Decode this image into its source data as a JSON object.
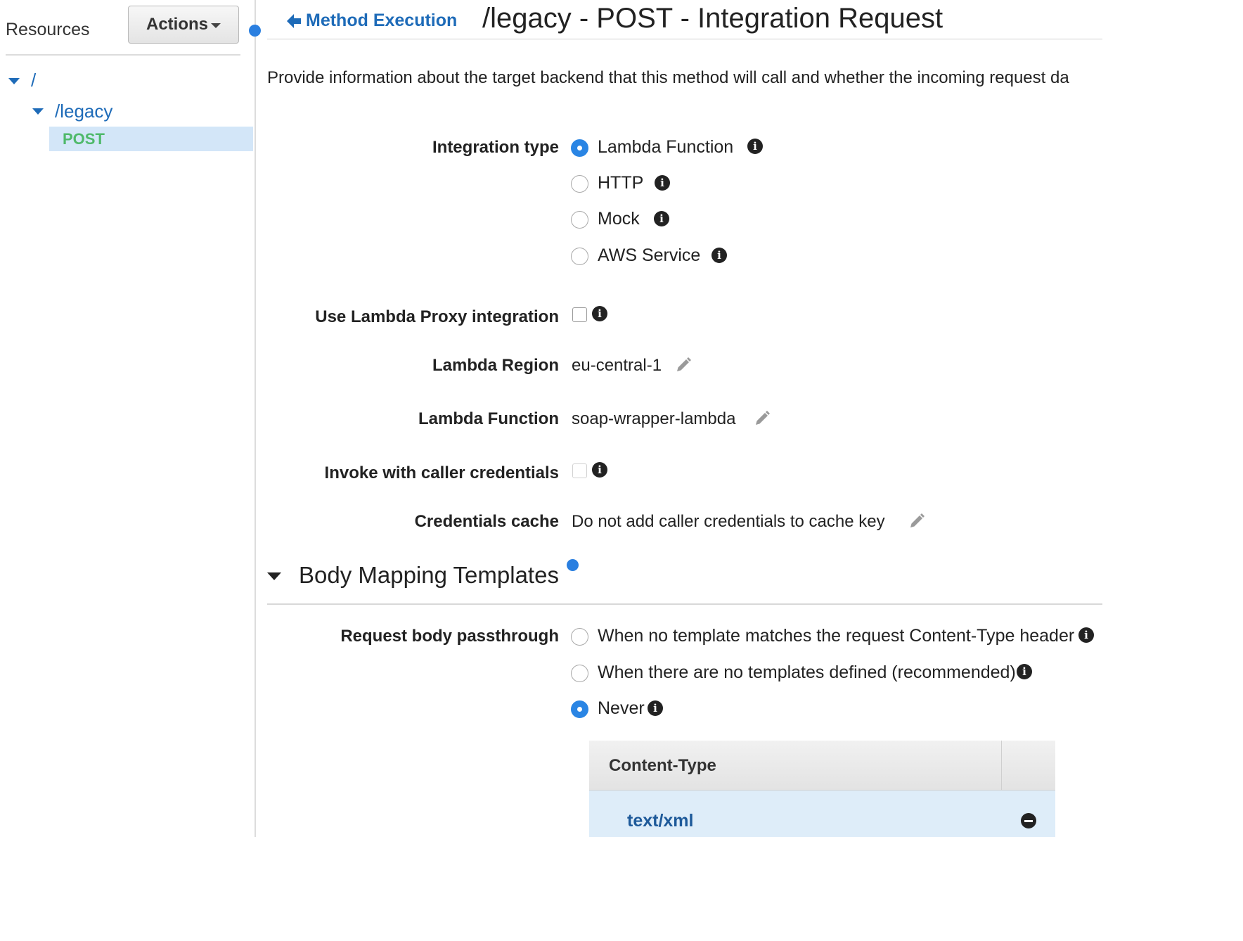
{
  "sidebar": {
    "title": "Resources",
    "actions_label": "Actions",
    "tree": {
      "root": "/",
      "child": "/legacy",
      "method": "POST"
    }
  },
  "header": {
    "back_link": "Method Execution",
    "title": "/legacy - POST - Integration Request"
  },
  "description": "Provide information about the target backend that this method will call and whether the incoming request da",
  "form": {
    "integration_type": {
      "label": "Integration type",
      "options": [
        "Lambda Function",
        "HTTP",
        "Mock",
        "AWS Service"
      ],
      "selected": "Lambda Function"
    },
    "lambda_proxy": {
      "label": "Use Lambda Proxy integration",
      "checked": false
    },
    "lambda_region": {
      "label": "Lambda Region",
      "value": "eu-central-1"
    },
    "lambda_function": {
      "label": "Lambda Function",
      "value": "soap-wrapper-lambda"
    },
    "invoke_with_caller_credentials": {
      "label": "Invoke with caller credentials",
      "checked": false
    },
    "credentials_cache": {
      "label": "Credentials cache",
      "value": "Do not add caller credentials to cache key"
    }
  },
  "body_mapping": {
    "section_title": "Body Mapping Templates",
    "passthrough": {
      "label": "Request body passthrough",
      "options": [
        "When no template matches the request Content-Type header",
        "When there are no templates defined (recommended)",
        "Never"
      ],
      "selected": "Never"
    },
    "table": {
      "header": "Content-Type",
      "rows": [
        "text/xml"
      ]
    }
  },
  "colors": {
    "accent": "#2a85e4",
    "link": "#1e6bb8",
    "method_post": "#4fb96a",
    "selected_row": "#d3e6f8"
  }
}
